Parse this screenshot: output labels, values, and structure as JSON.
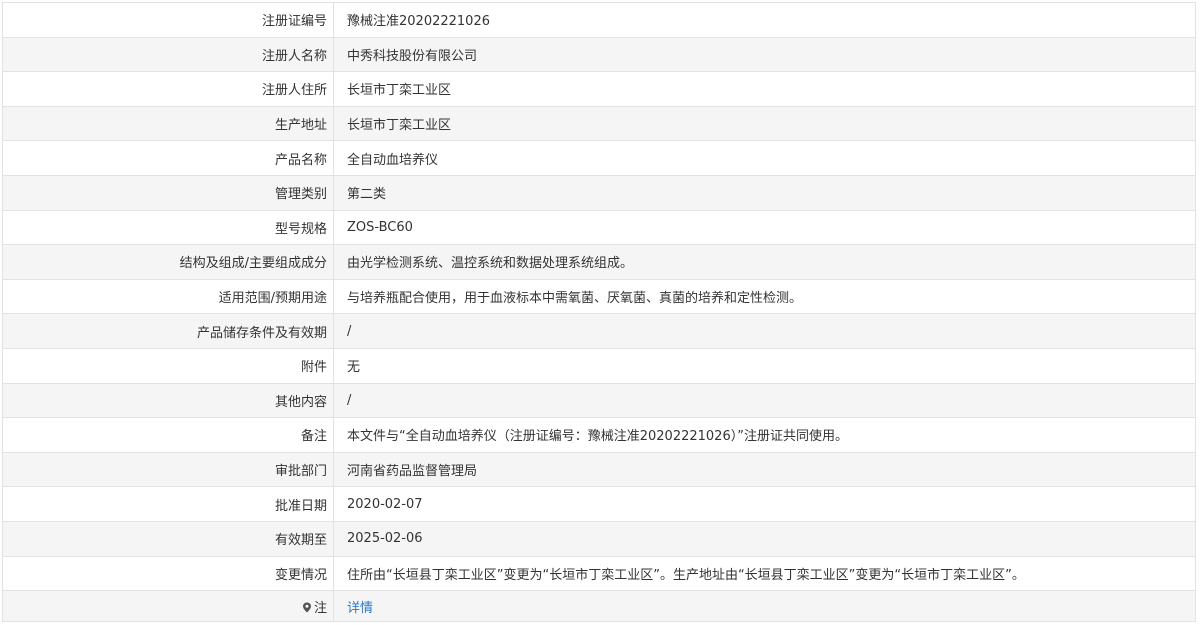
{
  "rows": [
    {
      "label": "注册证编号",
      "value": "豫械注准20202221026"
    },
    {
      "label": "注册人名称",
      "value": "中秀科技股份有限公司"
    },
    {
      "label": "注册人住所",
      "value": "长垣市丁栾工业区"
    },
    {
      "label": "生产地址",
      "value": "长垣市丁栾工业区"
    },
    {
      "label": "产品名称",
      "value": "全自动血培养仪"
    },
    {
      "label": "管理类别",
      "value": "第二类"
    },
    {
      "label": "型号规格",
      "value": "ZOS-BC60"
    },
    {
      "label": "结构及组成/主要组成成分",
      "value": "由光学检测系统、温控系统和数据处理系统组成。"
    },
    {
      "label": "适用范围/预期用途",
      "value": "与培养瓶配合使用，用于血液标本中需氧菌、厌氧菌、真菌的培养和定性检测。"
    },
    {
      "label": "产品储存条件及有效期",
      "value": "/"
    },
    {
      "label": "附件",
      "value": "无"
    },
    {
      "label": "其他内容",
      "value": "/"
    },
    {
      "label": "备注",
      "value": "本文件与“全自动血培养仪（注册证编号：豫械注准20202221026）”注册证共同使用。"
    },
    {
      "label": "审批部门",
      "value": "河南省药品监督管理局"
    },
    {
      "label": "批准日期",
      "value": "2020-02-07"
    },
    {
      "label": "有效期至",
      "value": "2025-02-06"
    },
    {
      "label": "变更情况",
      "value": "住所由“长垣县丁栾工业区”变更为“长垣市丁栾工业区”。生产地址由“长垣县丁栾工业区”变更为“长垣市丁栾工业区”。"
    }
  ],
  "note": {
    "label": "注",
    "icon": "map-pin-icon",
    "link_text": "详情",
    "link_color": "#2a78c8"
  }
}
